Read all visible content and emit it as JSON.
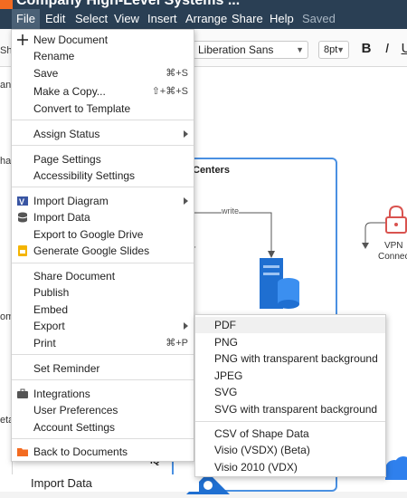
{
  "title": "Company High-Level Systems ...",
  "menubar": {
    "items": [
      "File",
      "Edit",
      "Select",
      "View",
      "Insert",
      "Arrange",
      "Share",
      "Help"
    ],
    "status": "Saved"
  },
  "toolbar": {
    "font": "Liberation Sans",
    "font_size": "8pt",
    "bold": "B",
    "italic": "I",
    "underline": "U"
  },
  "left_panel": {
    "fragments": [
      "Sha",
      "an",
      "hap",
      "om",
      "eta"
    ],
    "import_data": "Import Data"
  },
  "canvas": {
    "container_title": "Centers",
    "edge_label": "write",
    "vpn_label_1": "VPN",
    "vpn_label_2": "Connec",
    "fragment_r": "r",
    "fragment_iq": "IQ"
  },
  "file_menu": {
    "new_document": "New Document",
    "rename": "Rename",
    "save": "Save",
    "save_shortcut": "⌘+S",
    "make_copy": "Make a Copy...",
    "make_copy_shortcut": "⇧+⌘+S",
    "convert_template": "Convert to Template",
    "assign_status": "Assign Status",
    "page_settings": "Page Settings",
    "accessibility_settings": "Accessibility Settings",
    "import_diagram": "Import Diagram",
    "import_data": "Import Data",
    "export_google_drive": "Export to Google Drive",
    "generate_google_slides": "Generate Google Slides",
    "share_document": "Share Document",
    "publish": "Publish",
    "embed": "Embed",
    "export": "Export",
    "print": "Print",
    "print_shortcut": "⌘+P",
    "set_reminder": "Set Reminder",
    "integrations": "Integrations",
    "user_preferences": "User Preferences",
    "account_settings": "Account Settings",
    "back_to_documents": "Back to Documents"
  },
  "export_menu": {
    "pdf": "PDF",
    "png": "PNG",
    "png_transparent": "PNG with transparent background",
    "jpeg": "JPEG",
    "svg": "SVG",
    "svg_transparent": "SVG with transparent background",
    "csv": "CSV of Shape Data",
    "visio_vsdx": "Visio (VSDX) (Beta)",
    "visio_vdx": "Visio 2010 (VDX)"
  },
  "colors": {
    "header": "#2a3f54",
    "accent": "#f36b21",
    "diagram_blue": "#4a90e2",
    "vpn_red": "#d9534f"
  }
}
